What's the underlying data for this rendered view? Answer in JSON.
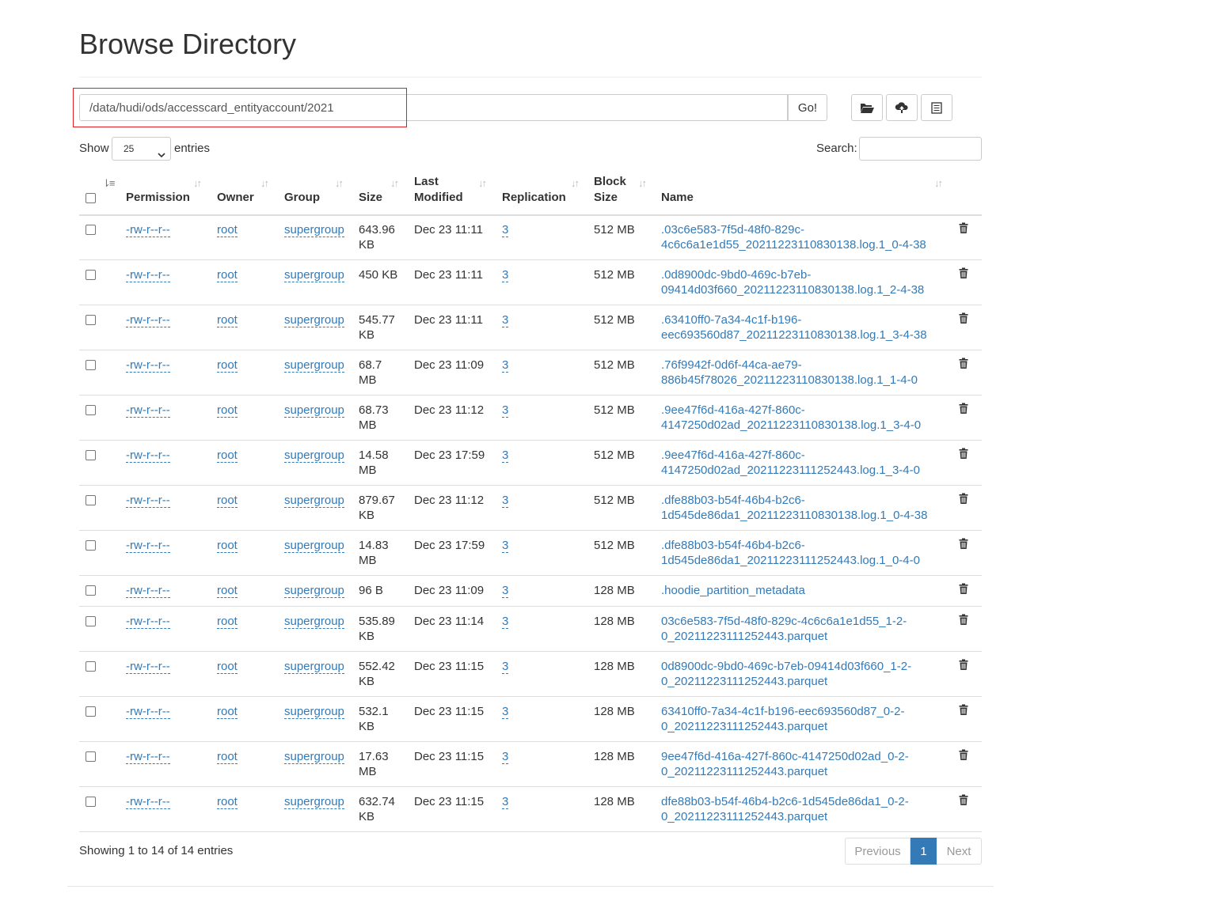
{
  "page": {
    "title": "Browse Directory"
  },
  "pathbar": {
    "value": "/data/hudi/ods/accesscard_entityaccount/2021",
    "go_label": "Go!"
  },
  "toolbar": {
    "icons": [
      "folder-open-icon",
      "cloud-upload-icon",
      "list-icon"
    ]
  },
  "controls": {
    "show_label": "Show",
    "page_size": "25",
    "entries_label": "entries",
    "search_label": "Search:"
  },
  "table": {
    "headers": {
      "permission": "Permission",
      "owner": "Owner",
      "group": "Group",
      "size": "Size",
      "last_modified_1": "Last",
      "last_modified_2": "Modified",
      "replication": "Replication",
      "block_size_1": "Block",
      "block_size_2": "Size",
      "name": "Name"
    },
    "rows": [
      {
        "permission": "-rw-r--r--",
        "owner": "root",
        "group": "supergroup",
        "size1": "643.96",
        "size2": "KB",
        "modified": "Dec 23 11:11",
        "replication": "3",
        "block": "512 MB",
        "name1": ".03c6e583-7f5d-48f0-829c-",
        "name2": "4c6c6a1e1d55_20211223110830138.log.1_0-4-38"
      },
      {
        "permission": "-rw-r--r--",
        "owner": "root",
        "group": "supergroup",
        "size1": "450 KB",
        "size2": "",
        "modified": "Dec 23 11:11",
        "replication": "3",
        "block": "512 MB",
        "name1": ".0d8900dc-9bd0-469c-b7eb-",
        "name2": "09414d03f660_20211223110830138.log.1_2-4-38"
      },
      {
        "permission": "-rw-r--r--",
        "owner": "root",
        "group": "supergroup",
        "size1": "545.77",
        "size2": "KB",
        "modified": "Dec 23 11:11",
        "replication": "3",
        "block": "512 MB",
        "name1": ".63410ff0-7a34-4c1f-b196-",
        "name2": "eec693560d87_20211223110830138.log.1_3-4-38"
      },
      {
        "permission": "-rw-r--r--",
        "owner": "root",
        "group": "supergroup",
        "size1": "68.7",
        "size2": "MB",
        "modified": "Dec 23 11:09",
        "replication": "3",
        "block": "512 MB",
        "name1": ".76f9942f-0d6f-44ca-ae79-",
        "name2": "886b45f78026_20211223110830138.log.1_1-4-0"
      },
      {
        "permission": "-rw-r--r--",
        "owner": "root",
        "group": "supergroup",
        "size1": "68.73",
        "size2": "MB",
        "modified": "Dec 23 11:12",
        "replication": "3",
        "block": "512 MB",
        "name1": ".9ee47f6d-416a-427f-860c-",
        "name2": "4147250d02ad_20211223110830138.log.1_3-4-0"
      },
      {
        "permission": "-rw-r--r--",
        "owner": "root",
        "group": "supergroup",
        "size1": "14.58",
        "size2": "MB",
        "modified": "Dec 23 17:59",
        "replication": "3",
        "block": "512 MB",
        "name1": ".9ee47f6d-416a-427f-860c-",
        "name2": "4147250d02ad_20211223111252443.log.1_3-4-0"
      },
      {
        "permission": "-rw-r--r--",
        "owner": "root",
        "group": "supergroup",
        "size1": "879.67",
        "size2": "KB",
        "modified": "Dec 23 11:12",
        "replication": "3",
        "block": "512 MB",
        "name1": ".dfe88b03-b54f-46b4-b2c6-",
        "name2": "1d545de86da1_20211223110830138.log.1_0-4-38"
      },
      {
        "permission": "-rw-r--r--",
        "owner": "root",
        "group": "supergroup",
        "size1": "14.83",
        "size2": "MB",
        "modified": "Dec 23 17:59",
        "replication": "3",
        "block": "512 MB",
        "name1": ".dfe88b03-b54f-46b4-b2c6-",
        "name2": "1d545de86da1_20211223111252443.log.1_0-4-0"
      },
      {
        "permission": "-rw-r--r--",
        "owner": "root",
        "group": "supergroup",
        "size1": "96 B",
        "size2": "",
        "modified": "Dec 23 11:09",
        "replication": "3",
        "block": "128 MB",
        "name1": ".hoodie_partition_metadata",
        "name2": ""
      },
      {
        "permission": "-rw-r--r--",
        "owner": "root",
        "group": "supergroup",
        "size1": "535.89",
        "size2": "KB",
        "modified": "Dec 23 11:14",
        "replication": "3",
        "block": "128 MB",
        "name1": "03c6e583-7f5d-48f0-829c-4c6c6a1e1d55_1-2-",
        "name2": "0_20211223111252443.parquet"
      },
      {
        "permission": "-rw-r--r--",
        "owner": "root",
        "group": "supergroup",
        "size1": "552.42",
        "size2": "KB",
        "modified": "Dec 23 11:15",
        "replication": "3",
        "block": "128 MB",
        "name1": "0d8900dc-9bd0-469c-b7eb-09414d03f660_1-2-",
        "name2": "0_20211223111252443.parquet"
      },
      {
        "permission": "-rw-r--r--",
        "owner": "root",
        "group": "supergroup",
        "size1": "532.1",
        "size2": "KB",
        "modified": "Dec 23 11:15",
        "replication": "3",
        "block": "128 MB",
        "name1": "63410ff0-7a34-4c1f-b196-eec693560d87_0-2-",
        "name2": "0_20211223111252443.parquet"
      },
      {
        "permission": "-rw-r--r--",
        "owner": "root",
        "group": "supergroup",
        "size1": "17.63",
        "size2": "MB",
        "modified": "Dec 23 11:15",
        "replication": "3",
        "block": "128 MB",
        "name1": "9ee47f6d-416a-427f-860c-4147250d02ad_0-2-",
        "name2": "0_20211223111252443.parquet"
      },
      {
        "permission": "-rw-r--r--",
        "owner": "root",
        "group": "supergroup",
        "size1": "632.74",
        "size2": "KB",
        "modified": "Dec 23 11:15",
        "replication": "3",
        "block": "128 MB",
        "name1": "dfe88b03-b54f-46b4-b2c6-1d545de86da1_0-2-",
        "name2": "0_20211223111252443.parquet"
      }
    ]
  },
  "footer": {
    "info": "Showing 1 to 14 of 14 entries",
    "previous": "Previous",
    "page": "1",
    "next": "Next"
  },
  "colors": {
    "link": "#337ab7",
    "highlight": "#e02020"
  }
}
